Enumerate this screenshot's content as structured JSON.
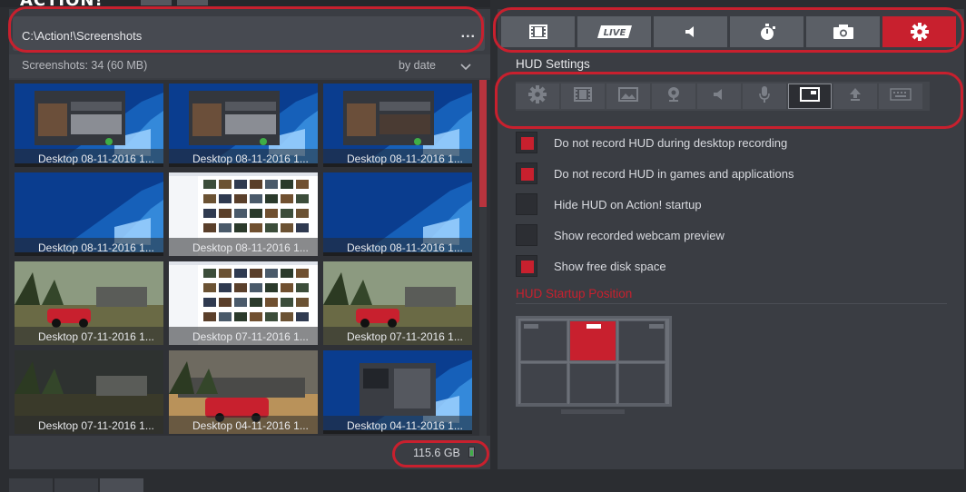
{
  "app": {
    "logo_text": "ACTION!"
  },
  "browser": {
    "path": "C:\\Action!\\Screenshots",
    "more_label": "...",
    "count_label": "Screenshots: 34 (60 MB)",
    "sort_label": "by date",
    "free_space": "115.6 GB",
    "thumbnails": [
      {
        "caption": "Desktop 08-11-2016 1...",
        "kind": "desktop-app"
      },
      {
        "caption": "Desktop 08-11-2016 1...",
        "kind": "desktop-app"
      },
      {
        "caption": "Desktop 08-11-2016 1...",
        "kind": "desktop-app-dark"
      },
      {
        "caption": "Desktop 08-11-2016 1...",
        "kind": "desktop"
      },
      {
        "caption": "Desktop 08-11-2016 1...",
        "kind": "explorer"
      },
      {
        "caption": "Desktop 08-11-2016 1...",
        "kind": "desktop"
      },
      {
        "caption": "Desktop 07-11-2016 1...",
        "kind": "game"
      },
      {
        "caption": "Desktop 07-11-2016 1...",
        "kind": "explorer-white"
      },
      {
        "caption": "Desktop 07-11-2016 1...",
        "kind": "game"
      },
      {
        "caption": "Desktop 07-11-2016 1...",
        "kind": "game-dark"
      },
      {
        "caption": "Desktop 04-11-2016 1...",
        "kind": "game-sand"
      },
      {
        "caption": "Desktop 04-11-2016 1...",
        "kind": "desktop-dialog"
      }
    ]
  },
  "tabs": [
    {
      "name": "video-tab",
      "icon": "film-icon",
      "active": false
    },
    {
      "name": "live-tab",
      "icon": "live-icon",
      "label": "LIVE",
      "active": false
    },
    {
      "name": "audio-tab",
      "icon": "speaker-icon",
      "active": false
    },
    {
      "name": "benchmark-tab",
      "icon": "stopwatch-icon",
      "active": false
    },
    {
      "name": "screenshot-tab",
      "icon": "camera-icon",
      "active": false
    },
    {
      "name": "settings-tab",
      "icon": "gear-icon",
      "active": true
    }
  ],
  "settings": {
    "section_title": "HUD Settings",
    "subtabs": [
      {
        "icon": "gear-icon",
        "active": false
      },
      {
        "icon": "film-icon",
        "active": false
      },
      {
        "icon": "image-icon",
        "active": false
      },
      {
        "icon": "webcam-icon",
        "active": false
      },
      {
        "icon": "speaker-icon",
        "active": false
      },
      {
        "icon": "microphone-icon",
        "active": false
      },
      {
        "icon": "hud-icon",
        "active": true
      },
      {
        "icon": "upload-icon",
        "active": false
      },
      {
        "icon": "keyboard-icon",
        "active": false
      }
    ],
    "options": [
      {
        "label": "Do not record HUD during desktop recording",
        "checked": true
      },
      {
        "label": "Do not record HUD in games and applications",
        "checked": true
      },
      {
        "label": "Hide HUD on Action! startup",
        "checked": false
      },
      {
        "label": "Show recorded webcam preview",
        "checked": false
      },
      {
        "label": "Show free disk space",
        "checked": true
      }
    ],
    "startup_position_title": "HUD Startup Position",
    "startup_position_selected": "top-center"
  },
  "colors": {
    "accent": "#c8202e",
    "panel": "#3a3d43",
    "background": "#2b2d31"
  }
}
